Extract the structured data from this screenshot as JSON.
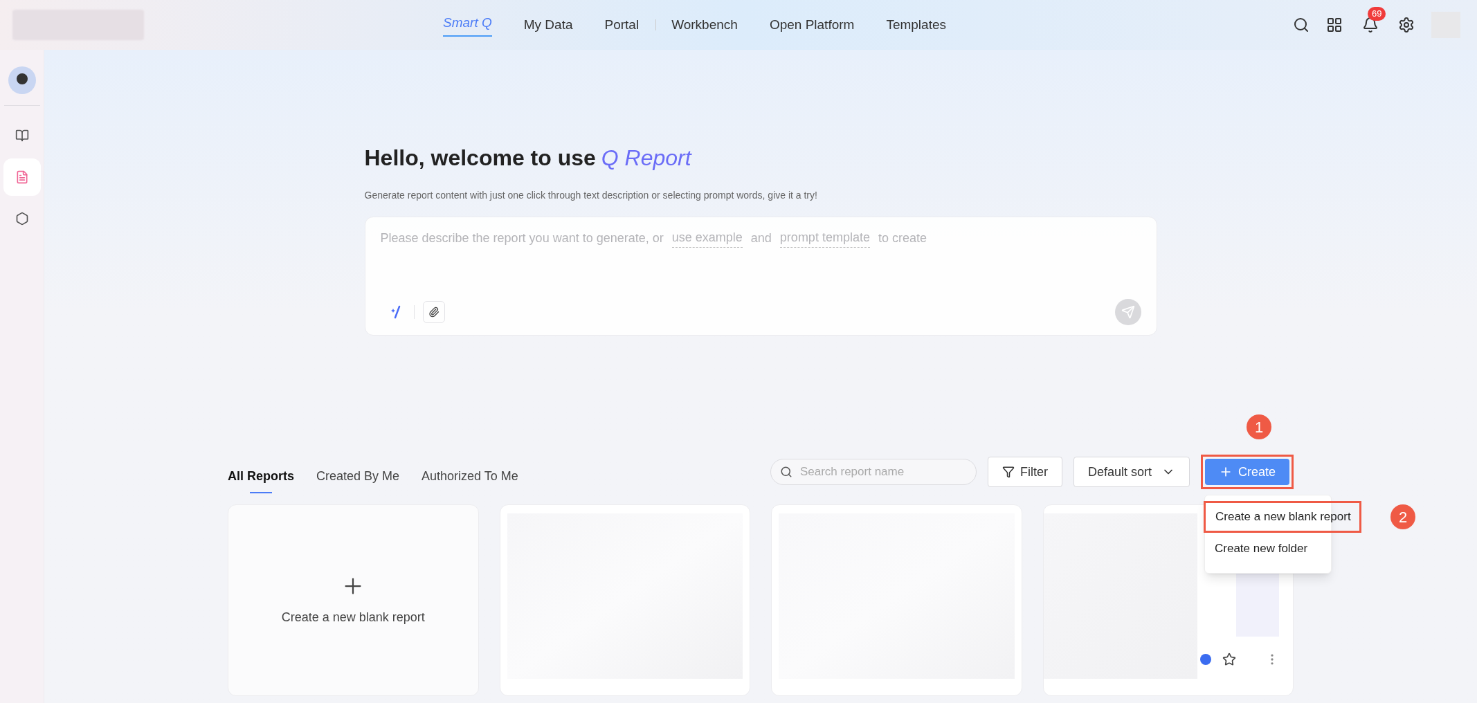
{
  "nav": {
    "items": [
      {
        "label": "Smart Q",
        "selected": true,
        "separator": false
      },
      {
        "label": "My Data",
        "selected": false,
        "separator": false
      },
      {
        "label": "Portal",
        "selected": false,
        "separator": false
      },
      {
        "label": "Workbench",
        "selected": false,
        "separator": true
      },
      {
        "label": "Open Platform",
        "selected": false,
        "separator": false
      },
      {
        "label": "Templates",
        "selected": false,
        "separator": false
      }
    ],
    "notifications": "69"
  },
  "sidebar": {
    "items": [
      {
        "kind": "book",
        "selected": false
      },
      {
        "kind": "report",
        "selected": true
      },
      {
        "kind": "chart",
        "selected": false
      }
    ]
  },
  "hero": {
    "title": "Hello, welcome to use",
    "brand": "Q Report",
    "subtitle": "Generate report content with just one click through text description or selecting prompt words, give it a try!",
    "prompt": [
      {
        "kind": "text",
        "text": "Please describe the report you want to generate, or"
      },
      {
        "kind": "link",
        "text": "use example"
      },
      {
        "kind": "text",
        "text": "and"
      },
      {
        "kind": "link",
        "text": "prompt template"
      },
      {
        "kind": "text",
        "text": "to create"
      }
    ]
  },
  "reports": {
    "tabs": [
      {
        "label": "All Reports",
        "selected": true
      },
      {
        "label": "Created By Me",
        "selected": false
      },
      {
        "label": "Authorized To Me",
        "selected": false
      }
    ],
    "search": {
      "placeholder": "Search report name"
    },
    "filter": "Filter",
    "sort": "Default sort",
    "create": {
      "label": "Create",
      "highlighted": true,
      "callout": "1"
    },
    "menu": [
      {
        "label": "Create a new blank report",
        "highlighted": true,
        "callout": "2"
      },
      {
        "label": "Create new folder",
        "highlighted": false
      }
    ],
    "new_card": "Create a new blank report"
  }
}
